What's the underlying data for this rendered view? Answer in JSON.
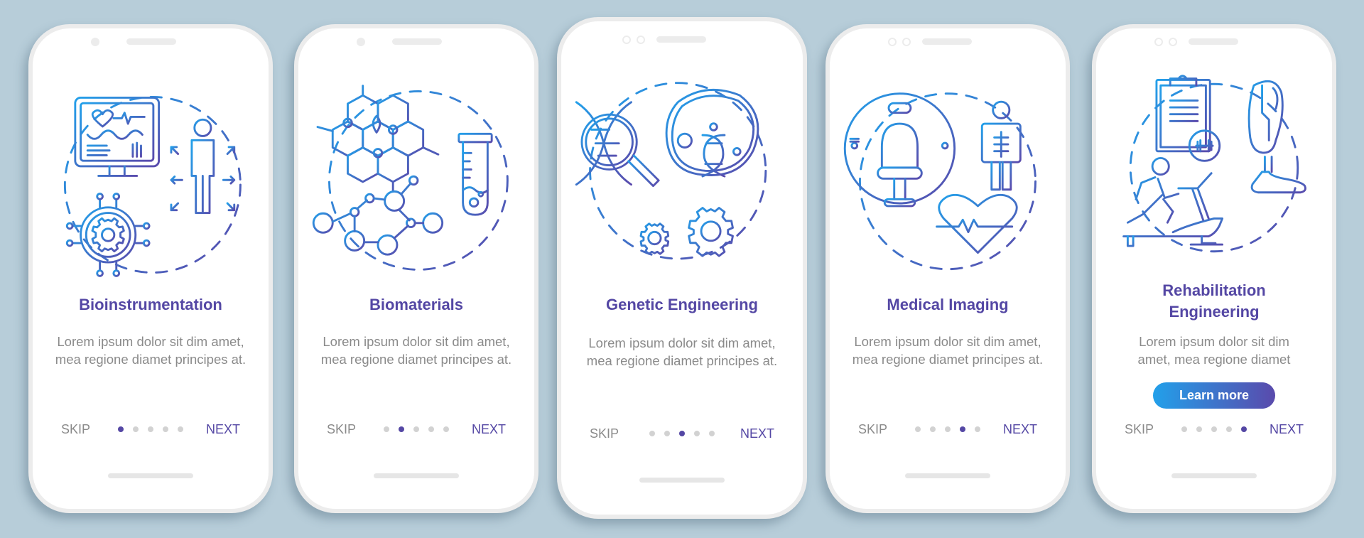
{
  "theme": {
    "background": "#b7cdd9",
    "accent": "#5447a4",
    "gradient_start": "#22a0ea",
    "gradient_end": "#5a4aac",
    "muted_text": "#8a8a8a"
  },
  "screens": [
    {
      "illustration": "bioinstrumentation-illustration",
      "title": "Bioinstrumentation",
      "description": "Lorem ipsum dolor sit dim amet, mea regione diamet principes at.",
      "skip_label": "SKIP",
      "next_label": "NEXT",
      "page_index": 1,
      "page_count": 5
    },
    {
      "illustration": "biomaterials-illustration",
      "title": "Biomaterials",
      "description": "Lorem ipsum dolor sit dim amet, mea regione diamet principes at.",
      "skip_label": "SKIP",
      "next_label": "NEXT",
      "page_index": 2,
      "page_count": 5
    },
    {
      "illustration": "genetic-engineering-illustration",
      "title": "Genetic Engineering",
      "description": "Lorem ipsum dolor sit dim amet, mea regione diamet principes at.",
      "skip_label": "SKIP",
      "next_label": "NEXT",
      "page_index": 3,
      "page_count": 5
    },
    {
      "illustration": "medical-imaging-illustration",
      "title": "Medical Imaging",
      "description": "Lorem ipsum dolor sit dim amet, mea regione diamet principes at.",
      "skip_label": "SKIP",
      "next_label": "NEXT",
      "page_index": 4,
      "page_count": 5
    },
    {
      "illustration": "rehabilitation-engineering-illustration",
      "title": "Rehabilitation Engineering",
      "description": "Lorem ipsum dolor sit dim amet, mea regione diamet",
      "button_label": "Learn more",
      "skip_label": "SKIP",
      "next_label": "NEXT",
      "page_index": 5,
      "page_count": 5
    }
  ]
}
